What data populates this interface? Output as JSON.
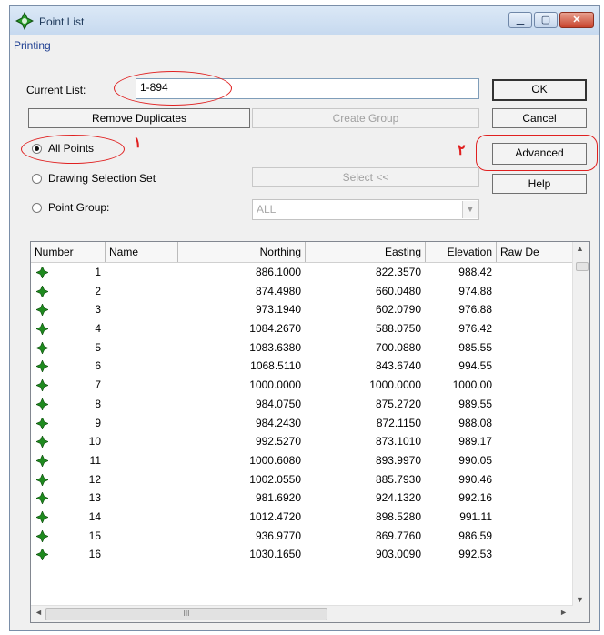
{
  "window": {
    "title": "Point List"
  },
  "menu": {
    "printing": "Printing"
  },
  "title_buttons": {
    "minimize": "▁",
    "maximize": "▢",
    "close": "✕"
  },
  "current_list": {
    "label": "Current List:",
    "value": "1-894"
  },
  "buttons": {
    "ok": "OK",
    "remove_duplicates": "Remove Duplicates",
    "create_group": "Create Group",
    "cancel": "Cancel",
    "advanced": "Advanced",
    "select": "Select <<",
    "help": "Help"
  },
  "radios": {
    "all_points": "All Points",
    "drawing_selection_set": "Drawing Selection Set",
    "point_group": "Point Group:"
  },
  "point_group_combo": {
    "value": "ALL"
  },
  "annotations": {
    "one": "١",
    "two": "٢"
  },
  "table": {
    "columns": [
      "Number",
      "Name",
      "Northing",
      "Easting",
      "Elevation",
      "Raw De"
    ],
    "rows": [
      [
        "1",
        "",
        "886.1000",
        "822.3570",
        "988.42"
      ],
      [
        "2",
        "",
        "874.4980",
        "660.0480",
        "974.88"
      ],
      [
        "3",
        "",
        "973.1940",
        "602.0790",
        "976.88"
      ],
      [
        "4",
        "",
        "1084.2670",
        "588.0750",
        "976.42"
      ],
      [
        "5",
        "",
        "1083.6380",
        "700.0880",
        "985.55"
      ],
      [
        "6",
        "",
        "1068.5110",
        "843.6740",
        "994.55"
      ],
      [
        "7",
        "",
        "1000.0000",
        "1000.0000",
        "1000.00"
      ],
      [
        "8",
        "",
        "984.0750",
        "875.2720",
        "989.55"
      ],
      [
        "9",
        "",
        "984.2430",
        "872.1150",
        "988.08"
      ],
      [
        "10",
        "",
        "992.5270",
        "873.1010",
        "989.17"
      ],
      [
        "11",
        "",
        "1000.6080",
        "893.9970",
        "990.05"
      ],
      [
        "12",
        "",
        "1002.0550",
        "885.7930",
        "990.46"
      ],
      [
        "13",
        "",
        "981.6920",
        "924.1320",
        "992.16"
      ],
      [
        "14",
        "",
        "1012.4720",
        "898.5280",
        "991.11"
      ],
      [
        "15",
        "",
        "936.9770",
        "869.7760",
        "986.59"
      ],
      [
        "16",
        "",
        "1030.1650",
        "903.0090",
        "992.53"
      ]
    ]
  },
  "scrollbar": {
    "up": "▲",
    "down": "▼",
    "left": "◄",
    "right": "►",
    "grip": "III"
  },
  "colors": {
    "annotation": "#e02020",
    "point_icon": "#1e8a1e"
  }
}
